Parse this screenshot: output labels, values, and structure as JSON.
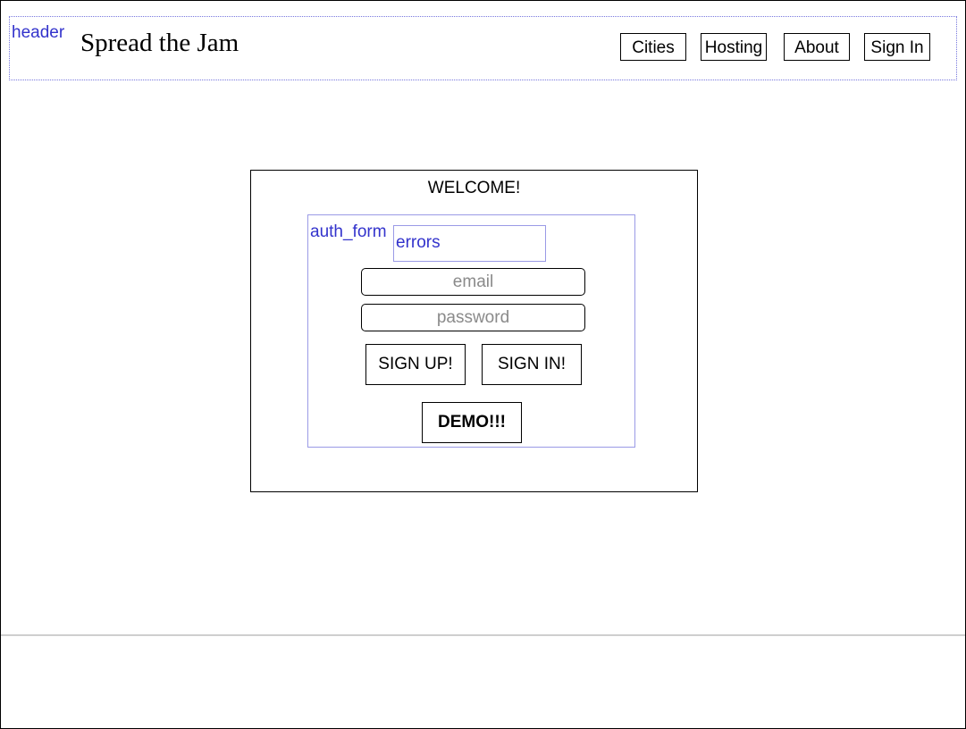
{
  "header": {
    "debug_label": "header",
    "site_title": "Spread the Jam",
    "nav": {
      "cities": "Cities",
      "hosting": "Hosting",
      "about": "About",
      "sign_in": "Sign In"
    }
  },
  "welcome": {
    "title": "WELCOME!",
    "auth_form": {
      "debug_label": "auth_form",
      "errors_label": "errors",
      "email_placeholder": "email",
      "password_placeholder": "password",
      "sign_up_label": "SIGN UP!",
      "sign_in_label": "SIGN IN!",
      "demo_label": "DEMO!!!"
    }
  },
  "colors": {
    "debug_text": "#3333cc",
    "debug_border": "#9a9ae6"
  }
}
